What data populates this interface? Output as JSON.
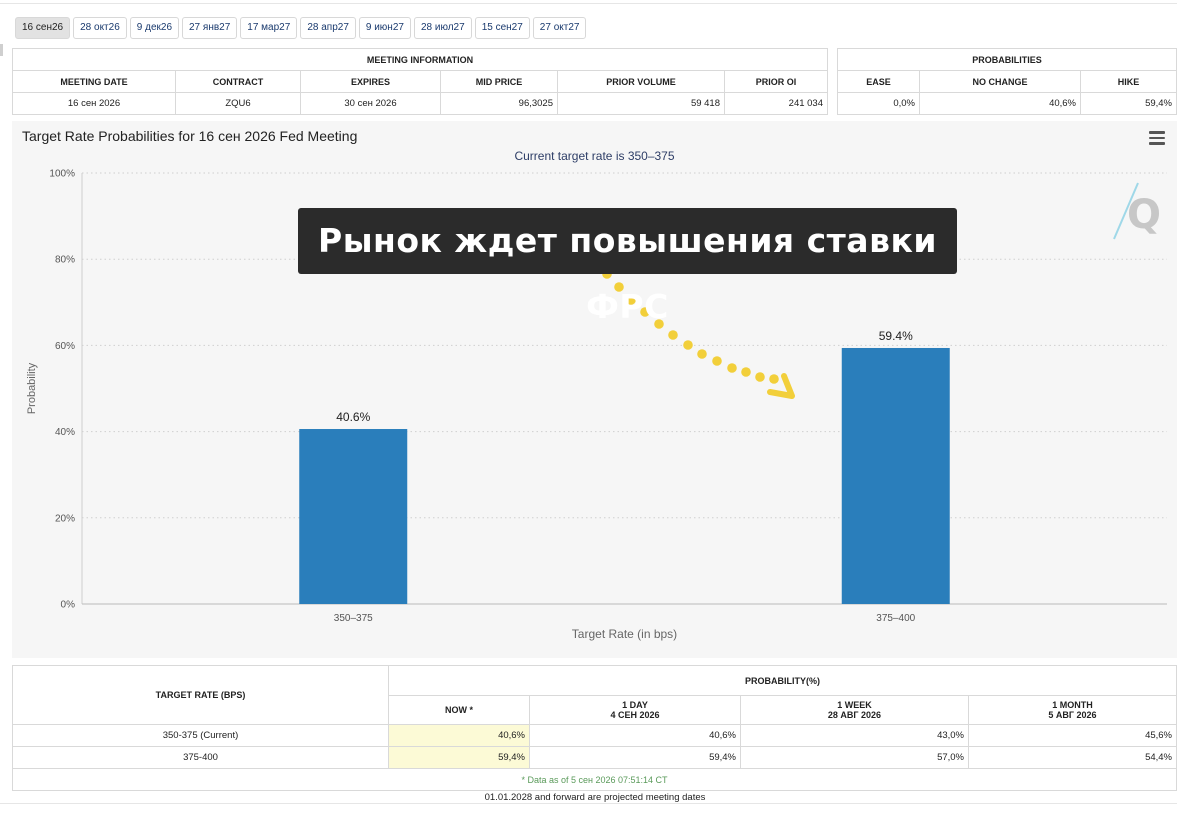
{
  "tabs": [
    "16 сен26",
    "28 окт26",
    "9 дек26",
    "27 янв27",
    "17 мар27",
    "28 апр27",
    "9 июн27",
    "28 июл27",
    "15 сен27",
    "27 окт27"
  ],
  "meeting_info": {
    "header": "MEETING INFORMATION",
    "columns": [
      "MEETING DATE",
      "CONTRACT",
      "EXPIRES",
      "MID PRICE",
      "PRIOR VOLUME",
      "PRIOR OI"
    ],
    "values": [
      "16 сен 2026",
      "ZQU6",
      "30 сен 2026",
      "96,3025",
      "59 418",
      "241 034"
    ]
  },
  "probabilities": {
    "header": "PROBABILITIES",
    "columns": [
      "EASE",
      "NO CHANGE",
      "HIKE"
    ],
    "values": [
      "0,0%",
      "40,6%",
      "59,4%"
    ]
  },
  "menu_icon": "hamburger-menu-icon",
  "watermark_icon": "q-logo-icon",
  "banner": {
    "text": "Рынок ждет повышения ставки ФРС"
  },
  "chart_data": {
    "type": "bar",
    "title": "Target Rate Probabilities for 16 сен 2026 Fed Meeting",
    "subtitle": "Current target rate is 350–375",
    "xlabel": "Target Rate (in bps)",
    "ylabel": "Probability",
    "categories": [
      "350–375",
      "375–400"
    ],
    "values": [
      40.6,
      59.4
    ],
    "data_labels": [
      "40.6%",
      "59.4%"
    ],
    "ylim": [
      0,
      100
    ],
    "yticks": [
      "0%",
      "20%",
      "40%",
      "60%",
      "80%",
      "100%"
    ],
    "ytick_values": [
      0,
      20,
      40,
      60,
      80,
      100
    ],
    "grid": true,
    "bar_color": "#2a7ebb",
    "arrow_color": "#f2cf3a"
  },
  "rate_table": {
    "target_header": "TARGET RATE (BPS)",
    "prob_header": "PROBABILITY(%)",
    "columns": [
      {
        "line1": "NOW *",
        "line2": ""
      },
      {
        "line1": "1 DAY",
        "line2": "4 СЕН 2026"
      },
      {
        "line1": "1 WEEK",
        "line2": "28 АВГ 2026"
      },
      {
        "line1": "1 MONTH",
        "line2": "5 АВГ 2026"
      }
    ],
    "rows": [
      {
        "rate": "350-375 (Current)",
        "values": [
          "40,6%",
          "40,6%",
          "43,0%",
          "45,6%"
        ]
      },
      {
        "rate": "375-400",
        "values": [
          "59,4%",
          "59,4%",
          "57,0%",
          "54,4%"
        ]
      }
    ],
    "note": "* Data as of 5 сен 2026 07:51:14 CT"
  },
  "footnote": "01.01.2028 and forward are projected meeting dates"
}
